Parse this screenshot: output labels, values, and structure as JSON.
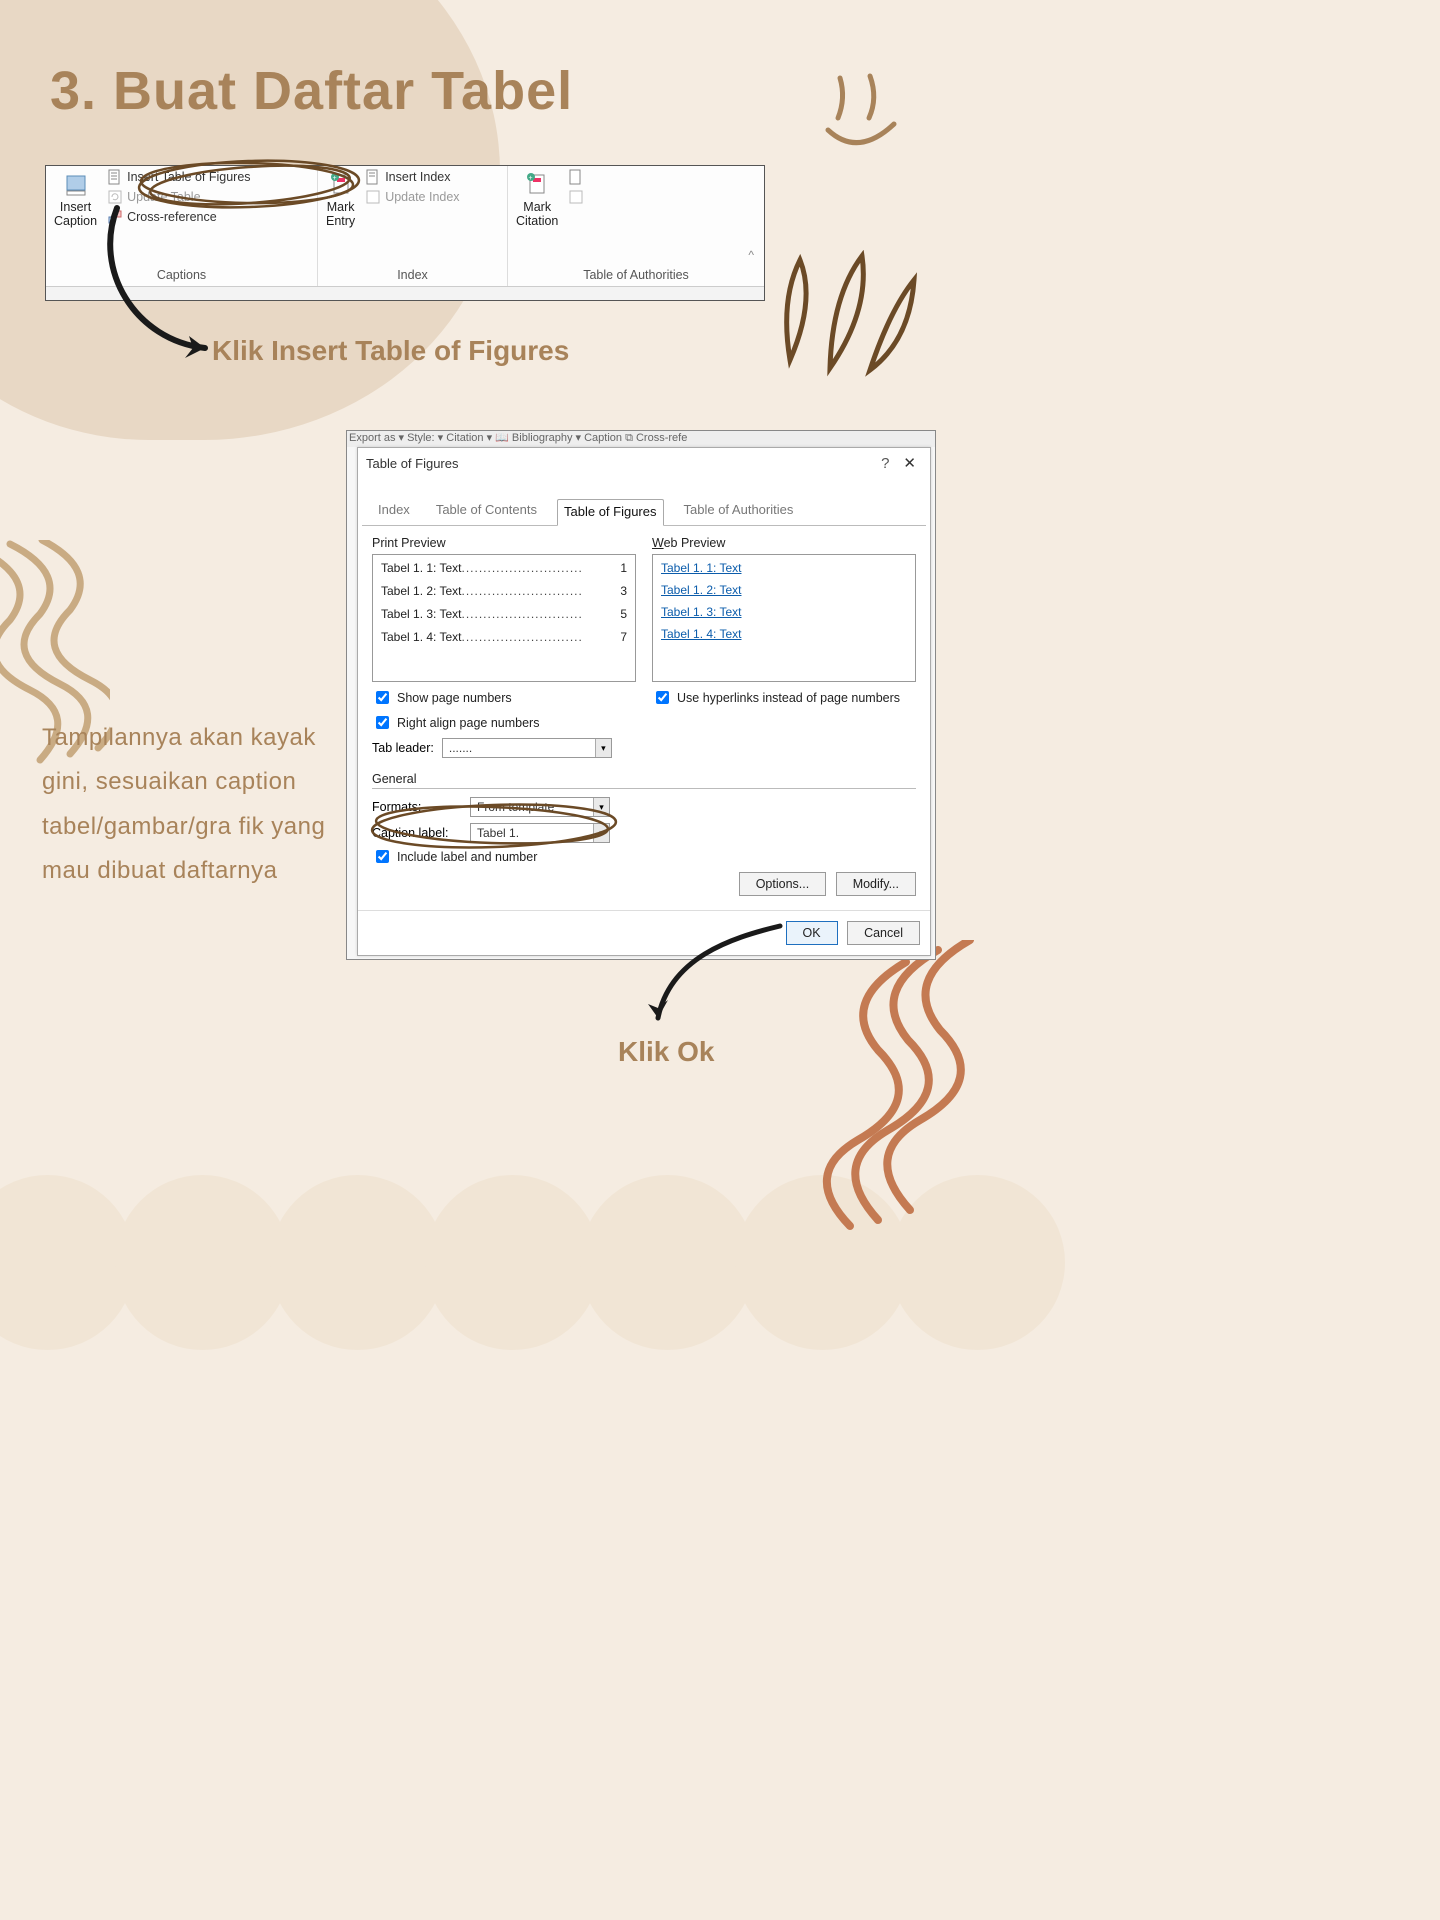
{
  "title": "3. Buat Daftar Tabel",
  "ribbon": {
    "captions": {
      "insert_caption": "Insert\nCaption",
      "insert_tof": "Insert Table of Figures",
      "update_table": "Update Table",
      "cross_ref": "Cross-reference",
      "group": "Captions"
    },
    "index": {
      "mark_entry": "Mark\nEntry",
      "insert_index": "Insert Index",
      "update_index": "Update Index",
      "group": "Index"
    },
    "toa": {
      "mark_citation": "Mark\nCitation",
      "group": "Table of Authorities"
    }
  },
  "instr1": "Klik Insert Table of Figures",
  "topstrip": "Export as ▾  Style:                               ▾   Citation ▾  📖 Bibliography ▾     Caption   ⧉ Cross-refe",
  "dialog": {
    "title": "Table of Figures",
    "tabs": [
      "Index",
      "Table of Contents",
      "Table of Figures",
      "Table of Authorities"
    ],
    "print_preview_h": "Print Preview",
    "web_preview_h": "Web Preview",
    "print_rows": [
      {
        "lab": "Tabel 1. 1: Text ",
        "pg": "1"
      },
      {
        "lab": "Tabel 1. 2: Text ",
        "pg": "3"
      },
      {
        "lab": "Tabel 1. 3: Text ",
        "pg": "5"
      },
      {
        "lab": "Tabel 1. 4: Text ",
        "pg": "7"
      }
    ],
    "web_rows": [
      "Tabel 1. 1: Text",
      "Tabel 1. 2: Text",
      "Tabel 1. 3: Text",
      "Tabel 1. 4: Text"
    ],
    "show_pn": "Show page numbers",
    "right_align": "Right align page numbers",
    "use_hyper": "Use hyperlinks instead of page numbers",
    "tab_leader_l": "Tab leader:",
    "tab_leader_v": ".......",
    "general_h": "General",
    "formats_l": "Formats:",
    "formats_v": "From template",
    "caption_l": "Caption label:",
    "caption_v": "Tabel 1.",
    "include_ln": "Include label and number",
    "options": "Options...",
    "modify": "Modify...",
    "ok": "OK",
    "cancel": "Cancel"
  },
  "bodytext": "Tampilannya akan kayak gini, sesuaikan caption tabel/gambar/gra fik yang mau dibuat daftarnya",
  "instr2": "Klik Ok"
}
